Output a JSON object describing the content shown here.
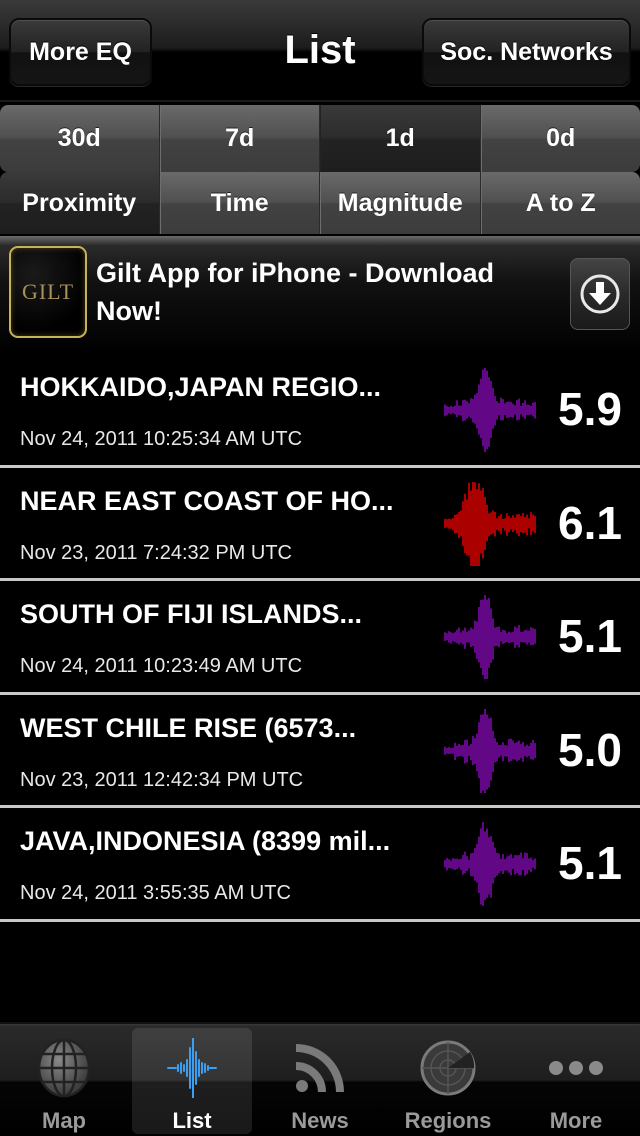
{
  "navbar": {
    "title": "List",
    "left_button": "More EQ",
    "right_button": "Soc. Networks"
  },
  "time_filter": {
    "options": [
      "30d",
      "7d",
      "1d",
      "0d"
    ],
    "selected": "1d"
  },
  "sort_filter": {
    "options": [
      "Proximity",
      "Time",
      "Magnitude",
      "A to Z"
    ],
    "selected": "Proximity"
  },
  "ad": {
    "logo_text": "GILT",
    "text": "Gilt App for iPhone - Download Now!",
    "download_icon": "download-arrow-icon"
  },
  "colors": {
    "normal_wave": "#7a0aa8",
    "strong_wave": "#d40000",
    "separator": "#c8c8c8",
    "tab_active_icon": "#3a9ff0"
  },
  "earthquakes": [
    {
      "title": "HOKKAIDO,JAPAN REGIO...",
      "date": "Nov 24, 2011 10:25:34 AM UTC",
      "magnitude": "5.9",
      "level": "normal"
    },
    {
      "title": "NEAR EAST COAST OF HO...",
      "date": "Nov 23, 2011 7:24:32 PM UTC",
      "magnitude": "6.1",
      "level": "strong"
    },
    {
      "title": "SOUTH OF FIJI ISLANDS...",
      "date": "Nov 24, 2011 10:23:49 AM UTC",
      "magnitude": "5.1",
      "level": "normal"
    },
    {
      "title": "WEST CHILE RISE (6573...",
      "date": "Nov 23, 2011 12:42:34 PM UTC",
      "magnitude": "5.0",
      "level": "normal"
    },
    {
      "title": "JAVA,INDONESIA (8399 mil...",
      "date": "Nov 24, 2011 3:55:35 AM UTC",
      "magnitude": "5.1",
      "level": "normal"
    }
  ],
  "tabbar": {
    "items": [
      {
        "label": "Map",
        "icon": "globe-icon"
      },
      {
        "label": "List",
        "icon": "seismograph-icon",
        "active": true
      },
      {
        "label": "News",
        "icon": "rss-icon"
      },
      {
        "label": "Regions",
        "icon": "radar-icon"
      },
      {
        "label": "More",
        "icon": "more-dots-icon"
      }
    ]
  }
}
